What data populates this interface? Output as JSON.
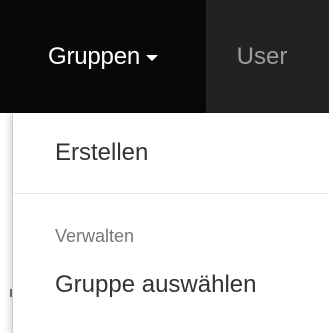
{
  "navbar": {
    "gruppen_label": "Gruppen",
    "user_label": "User"
  },
  "dropdown": {
    "erstellen": "Erstellen",
    "header_verwalten": "Verwalten",
    "gruppe_auswaehlen": "Gruppe auswählen"
  },
  "colors": {
    "navbar_bg": "#222222",
    "active_nav_bg": "#080808",
    "inactive_nav_text": "#9d9d9d",
    "menu_text": "#333333",
    "menu_header_text": "#777777"
  },
  "icons": {
    "caret": "caret-down-icon"
  }
}
